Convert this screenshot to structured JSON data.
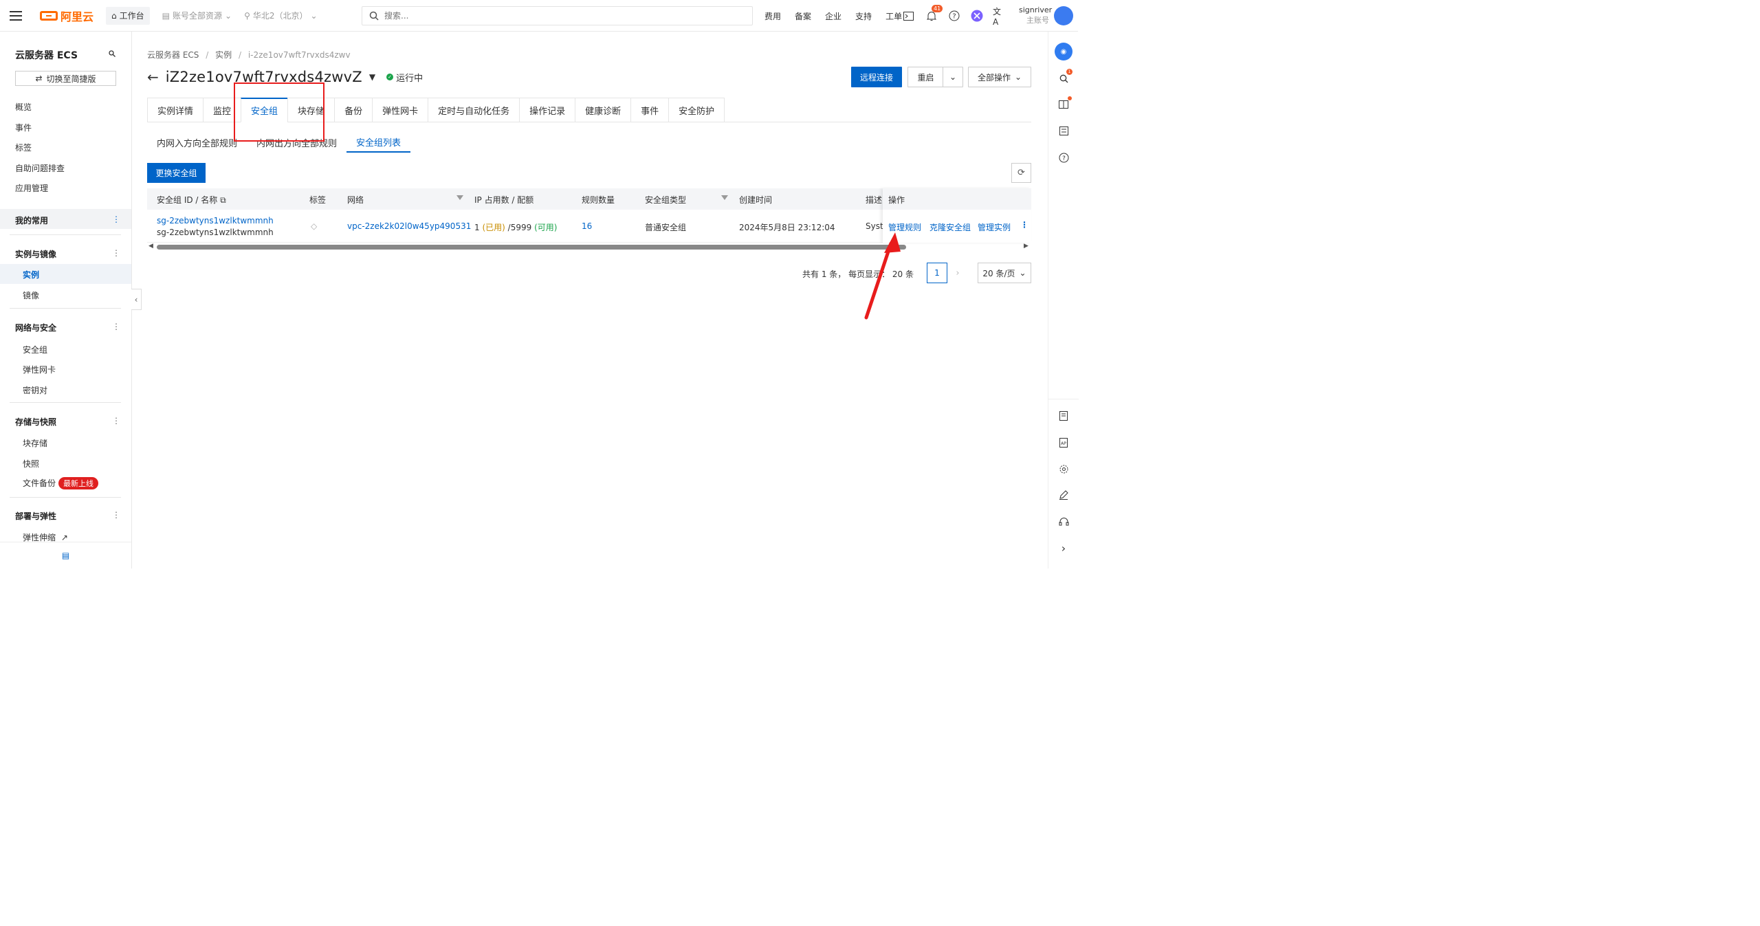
{
  "topbar": {
    "brand": "阿里云",
    "workbench": "工作台",
    "account_scope": "账号全部资源",
    "region": "华北2（北京）",
    "search_placeholder": "搜索...",
    "nav": [
      "费用",
      "备案",
      "企业",
      "支持",
      "工单"
    ],
    "notification_count": "41",
    "user_name": "signriver",
    "user_role": "主账号"
  },
  "sidebar": {
    "title": "云服务器 ECS",
    "switch_label": "切换至简捷版",
    "items": [
      "概览",
      "事件",
      "标签",
      "自助问题排查",
      "应用管理"
    ],
    "group_favorites": "我的常用",
    "group_instances": "实例与镜像",
    "instances": "实例",
    "images": "镜像",
    "group_network": "网络与安全",
    "security_group": "安全组",
    "eni": "弹性网卡",
    "keypair": "密钥对",
    "group_storage": "存储与快照",
    "block_storage": "块存储",
    "snapshot": "快照",
    "file_backup": "文件备份",
    "new_badge": "最新上线",
    "group_deploy": "部署与弹性",
    "auto_scaling": "弹性伸缩"
  },
  "breadcrumb": {
    "root": "云服务器 ECS",
    "sep": "/",
    "mid": "实例",
    "current": "i-2ze1ov7wft7rvxds4zwv"
  },
  "instance": {
    "name": "iZ2ze1ov7wft7rvxds4zwvZ",
    "status": "运行中"
  },
  "actions": {
    "remote": "远程连接",
    "restart": "重启",
    "all_ops": "全部操作"
  },
  "tabs": [
    "实例详情",
    "监控",
    "安全组",
    "块存储",
    "备份",
    "弹性网卡",
    "定时与自动化任务",
    "操作记录",
    "健康诊断",
    "事件",
    "安全防护"
  ],
  "subtabs": [
    "内网入方向全部规则",
    "内网出方向全部规则",
    "安全组列表"
  ],
  "change_sg_button": "更换安全组",
  "table": {
    "headers": {
      "id_name": "安全组 ID / 名称",
      "tag": "标签",
      "network": "网络",
      "ip": "IP 占用数 / 配额",
      "rules": "规则数量",
      "type": "安全组类型",
      "created": "创建时间",
      "desc": "描述",
      "ops": "操作"
    },
    "row": {
      "id": "sg-2zebwtyns1wzlktwmmnh",
      "name": "sg-2zebwtyns1wzlktwmmnh",
      "vpc": "vpc-2zek2k02l0w45yp490531",
      "ip_used": "1",
      "ip_used_label": "(已用)",
      "ip_quota": "/5999",
      "ip_avail_label": "(可用)",
      "rules": "16",
      "type": "普通安全组",
      "created": "2024年5月8日 23:12:04",
      "desc": "Syste",
      "op_manage_rules": "管理规则",
      "op_clone": "克隆安全组",
      "op_manage_instances": "管理实例"
    }
  },
  "pagination": {
    "info": "共有 1 条， 每页显示： 20 条",
    "current": "1",
    "page_size": "20 条/页"
  }
}
